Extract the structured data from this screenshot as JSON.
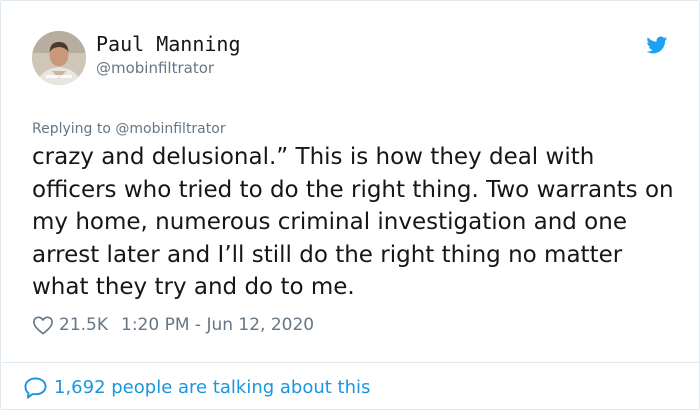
{
  "author": {
    "display_name": "Paul Manning",
    "handle": "@mobinfiltrator",
    "avatar": "profile-photo"
  },
  "reply_context": "Replying to @mobinfiltrator",
  "tweet": {
    "text": "crazy and delusional.” This is how they deal with officers who tried to do the right thing. Two warrants on my home, numerous criminal investigation and one arrest later and I’ll still do the right thing no matter what they try and do to me."
  },
  "meta": {
    "likes": "21.5K",
    "timestamp": "1:20 PM - Jun 12, 2020"
  },
  "footer": {
    "talking": "1,692 people are talking about this"
  },
  "icons": {
    "brand": "twitter-bird-icon",
    "like": "heart-icon",
    "reply": "speech-bubble-icon"
  },
  "colors": {
    "brand_blue": "#1da1f2",
    "link_blue": "#1b95e0",
    "secondary_text": "#657786",
    "text": "#14171a",
    "border": "#e1e8ed"
  }
}
